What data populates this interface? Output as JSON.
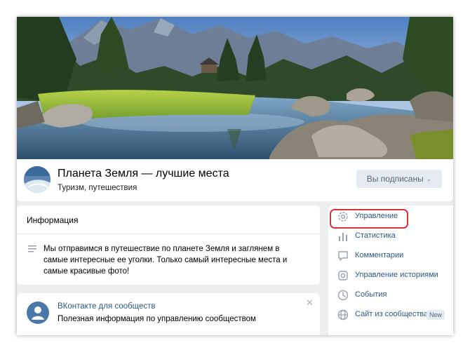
{
  "community": {
    "title": "Планета Земля — лучшие места",
    "subtitle": "Туризм, путешествия",
    "subscribe_label": "Вы подписаны",
    "subscribe_chevron": "⌄"
  },
  "info": {
    "title": "Информация",
    "description": "Мы отправимся в путешествие по планете Земля и заглянем в самые интересные ее уголки. Только самый интересные места и самые красивые фото!"
  },
  "promo": {
    "title": "ВКонтакте для сообществ",
    "text": "Полезная информация по управлению сообществом",
    "close": "✕"
  },
  "menu": {
    "items": [
      {
        "label": "Управление",
        "icon": "gear-icon"
      },
      {
        "label": "Статистика",
        "icon": "stats-icon"
      },
      {
        "label": "Комментарии",
        "icon": "comment-icon"
      },
      {
        "label": "Управление историями",
        "icon": "stories-icon"
      },
      {
        "label": "События",
        "icon": "clock-icon"
      },
      {
        "label": "Сайт из сообщества",
        "icon": "globe-icon",
        "badge": "New"
      }
    ]
  },
  "colors": {
    "link": "#2a5885",
    "background": "#edeef0",
    "highlight": "#d8313b",
    "button_bg": "#e5ebf1"
  }
}
